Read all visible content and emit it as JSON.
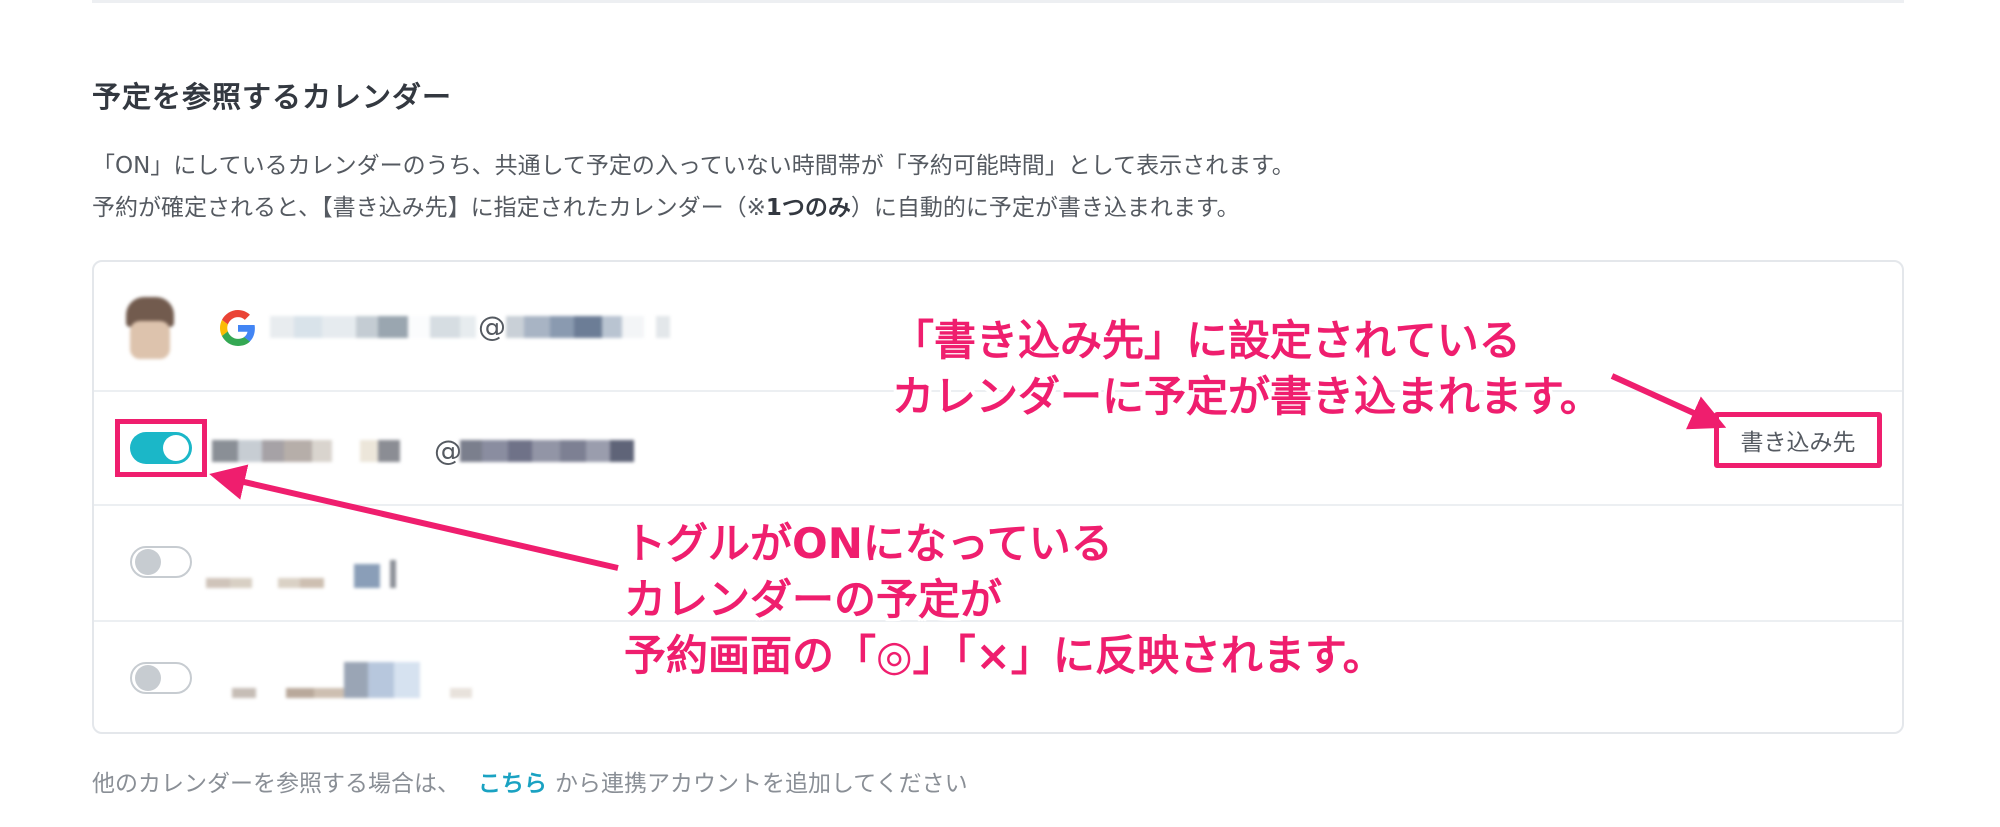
{
  "section": {
    "title": "予定を参照するカレンダー",
    "desc_line1": "「ON」にしているカレンダーのうち、共通して予定の入っていない時間帯が「予約可能時間」として表示されます。",
    "desc_line2_pre": "予約が確定されると、【書き込み先】に指定されたカレンダー（※",
    "desc_line2_bold": "1つのみ",
    "desc_line2_post": "）に自動的に予定が書き込まれます。"
  },
  "calendars": {
    "account": {
      "avatar": "avatar-photo",
      "provider_icon": "google-g-icon",
      "email_at": "@"
    },
    "rows": [
      {
        "toggle_on": true,
        "email_at": "@",
        "badge": "書き込み先"
      },
      {
        "toggle_on": false
      },
      {
        "toggle_on": false
      }
    ]
  },
  "footer": {
    "pre": "他のカレンダーを参照する場合は、",
    "link": "こちら",
    "post": "から連携アカウントを追加してください"
  },
  "annotations": {
    "callout_write": [
      "「書き込み先」に設定されている",
      "カレンダーに予定が書き込まれます。"
    ],
    "callout_toggle": [
      "トグルがONになっている",
      "カレンダーの予定が",
      "予約画面の「◎」「×」に反映されます。"
    ],
    "color": "#ef1e6e"
  },
  "colors": {
    "accent": "#1bb7c8",
    "link": "#1aa2c2",
    "annotation": "#ef1e6e"
  }
}
